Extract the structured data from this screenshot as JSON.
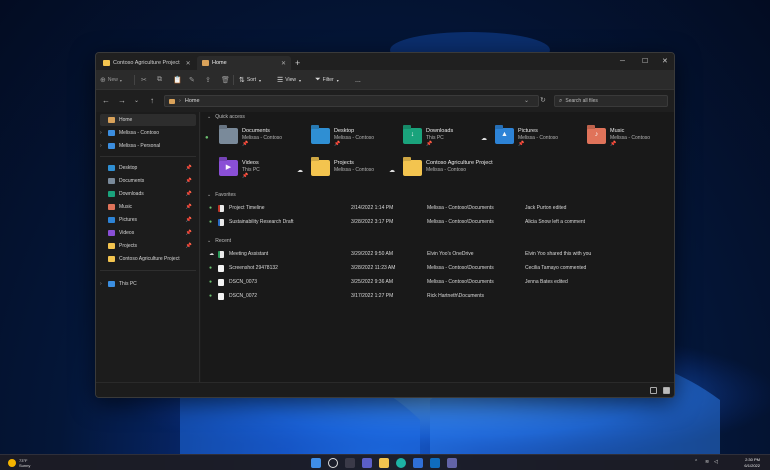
{
  "colors": {
    "folder_yellow": "#f3c44f",
    "documents": "#7a8a9a",
    "desktop": "#2f8fd3",
    "downloads": "#1aa37c",
    "pictures": "#2d83d6",
    "music": "#e0735a",
    "videos": "#8a4fd6",
    "accent": "#4aa3ff"
  },
  "window": {
    "tabs": [
      {
        "label": "Contoso Agriculture Project",
        "icon": "folder-icon"
      },
      {
        "label": "Home",
        "icon": "home-icon"
      }
    ]
  },
  "toolbar": {
    "new_label": "New",
    "sort_label": "Sort",
    "view_label": "View",
    "filter_label": "Filter",
    "more_label": "..."
  },
  "address": {
    "path": "Home",
    "search_placeholder": "Search all files"
  },
  "sidebar": {
    "top": [
      {
        "label": "Home",
        "icon": "home-icon"
      },
      {
        "label": "Melissa - Contoso",
        "icon": "cloud-icon"
      },
      {
        "label": "Melissa - Personal",
        "icon": "cloud-icon"
      }
    ],
    "pinned": [
      {
        "label": "Desktop",
        "icon": "desktop-icon"
      },
      {
        "label": "Documents",
        "icon": "documents-icon"
      },
      {
        "label": "Downloads",
        "icon": "downloads-icon"
      },
      {
        "label": "Music",
        "icon": "music-icon"
      },
      {
        "label": "Pictures",
        "icon": "pictures-icon"
      },
      {
        "label": "Videos",
        "icon": "videos-icon"
      },
      {
        "label": "Projects",
        "icon": "folder-icon"
      },
      {
        "label": "Contoso Agriculture Project",
        "icon": "folder-icon"
      }
    ],
    "this_pc": {
      "label": "This PC",
      "icon": "pc-icon"
    }
  },
  "quick_access": {
    "heading": "Quick access",
    "items": [
      {
        "name": "Documents",
        "location": "Melissa - Contoso"
      },
      {
        "name": "Desktop",
        "location": "Melissa - Contoso"
      },
      {
        "name": "Downloads",
        "location": "This PC"
      },
      {
        "name": "Pictures",
        "location": "Melissa - Contoso"
      },
      {
        "name": "Music",
        "location": "Melissa - Contoso"
      },
      {
        "name": "Videos",
        "location": "This PC"
      },
      {
        "name": "Projects",
        "location": "Melissa - Contoso"
      },
      {
        "name": "Contoso Agriculture Project",
        "location": "Melissa - Contoso"
      }
    ]
  },
  "favorites": {
    "heading": "Favorites",
    "rows": [
      {
        "name": "Project Timeline",
        "date": "2/14/2022 1:14 PM",
        "location": "Melissa - Contoso\\Documents",
        "activity": "Jack Purton edited"
      },
      {
        "name": "Sustainability Research Draft",
        "date": "3/28/2022 3:17 PM",
        "location": "Melissa - Contoso\\Documents",
        "activity": "Alicia Snow left a comment"
      }
    ]
  },
  "recent": {
    "heading": "Recent",
    "rows": [
      {
        "name": "Meeting Assistant",
        "date": "3/29/2022 9:50 AM",
        "location": "Elvin Yoo's OneDrive",
        "activity": "Elvin Yoo shared this with you"
      },
      {
        "name": "Screenshot 29478132",
        "date": "3/28/2022 11:23 AM",
        "location": "Melissa - Contoso\\Documents",
        "activity": "Cecilia Tamayo commented"
      },
      {
        "name": "DSCN_0073",
        "date": "3/25/2022 9:36 AM",
        "location": "Melissa - Contoso\\Documents",
        "activity": "Jenna Bates edited"
      },
      {
        "name": "DSCN_0072",
        "date": "3/17/2022 1:27 PM",
        "location": "Rick Hartneth\\Documents",
        "activity": ""
      }
    ]
  },
  "taskbar": {
    "weather_temp": "73°F",
    "weather_desc": "Sunny",
    "time": "2:30 PM",
    "date": "6/1/2022"
  }
}
